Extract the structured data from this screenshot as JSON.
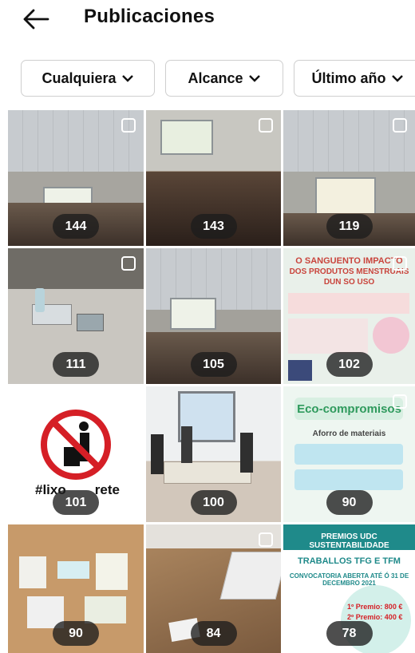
{
  "header": {
    "title": "Publicaciones",
    "back_icon": "arrow-left-icon"
  },
  "filters": [
    {
      "label": "Cualquiera"
    },
    {
      "label": "Alcance"
    },
    {
      "label": "Último año"
    }
  ],
  "posts": [
    {
      "count": "144",
      "multi": true
    },
    {
      "count": "143",
      "multi": true
    },
    {
      "count": "119",
      "multi": true
    },
    {
      "count": "111",
      "multi": true
    },
    {
      "count": "105",
      "multi": false
    },
    {
      "count": "102",
      "multi": true
    },
    {
      "count": "101",
      "multi": false
    },
    {
      "count": "100",
      "multi": false
    },
    {
      "count": "90",
      "multi": true
    },
    {
      "count": "90",
      "multi": false
    },
    {
      "count": "84",
      "multi": true
    },
    {
      "count": "78",
      "multi": false
    }
  ],
  "post_texts": {
    "p6_title_1": "O SANGUENTO IMPACTO",
    "p6_title_2": "DOS PRODUTOS MENSTRUAIS",
    "p6_title_3": "DUN SO USO",
    "p7_hashtag": "#lixo",
    "p7_hashtag_end": "rete",
    "p9_title": "Eco-compromisos",
    "p9_sub": "Aforro de materiais",
    "p12_title": "PREMIOS UDC SUSTENTABILIDADE",
    "p12_sub": "TRABALLOS TFG E TFM",
    "p12_date": "CONVOCATORIA ABERTA ATÉ Ó 31 DE DECEMBRO 2021",
    "p12_prize1": "1º Premio: 800 €",
    "p12_prize2": "2º Premio: 400 €"
  },
  "colors": {
    "badge_bg": "#1c1c1c",
    "chip_border": "#cfcfcf",
    "p6_red": "#c9443c",
    "p9_green": "#2f9a5d",
    "p12_teal": "#1f8a8a"
  }
}
